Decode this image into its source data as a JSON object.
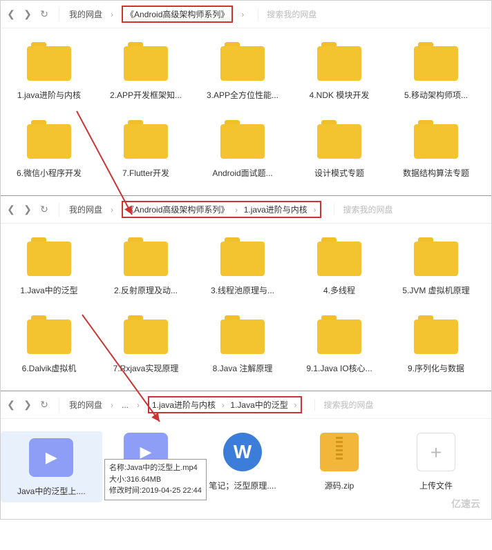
{
  "nav1": {
    "home": "我的网盘",
    "crumb1": "《Android高级架构师系列》",
    "search": "搜索我的网盘"
  },
  "nav2": {
    "home": "我的网盘",
    "crumb1": "《Android高级架构师系列》",
    "crumb2": "1.java进阶与内核",
    "search": "搜索我的网盘"
  },
  "nav3": {
    "home": "我的网盘",
    "ellipsis": "...",
    "crumb1": "1.java进阶与内核",
    "crumb2": "1.Java中的泛型",
    "search": "搜索我的网盘"
  },
  "p1": [
    "1.java进阶与内核",
    "2.APP开发框架知...",
    "3.APP全方位性能...",
    "4.NDK 模块开发",
    "5.移动架构师项...",
    "6.微信小程序开发",
    "7.Flutter开发",
    "Android面试题...",
    "设计模式专题",
    "数据结构算法专题"
  ],
  "p2": [
    "1.Java中的泛型",
    "2.反射原理及动...",
    "3.线程池原理与...",
    "4.多线程",
    "5.JVM 虚拟机原理",
    "6.Dalvik虚拟机",
    "7.Rxjava实现原理",
    "8.Java 注解原理",
    "9.1.Java IO核心...",
    "9.序列化与数据"
  ],
  "p3": {
    "i0": "Java中的泛型上....",
    "i1": "",
    "i2": "笔记；泛型原理....",
    "i3": "源码.zip",
    "i4": "上传文件"
  },
  "tip": {
    "l1": "名称:Java中的泛型上.mp4",
    "l2": "大小:316.64MB",
    "l3": "修改时间:2019-04-25 22:44"
  },
  "watermark": "亿速云"
}
